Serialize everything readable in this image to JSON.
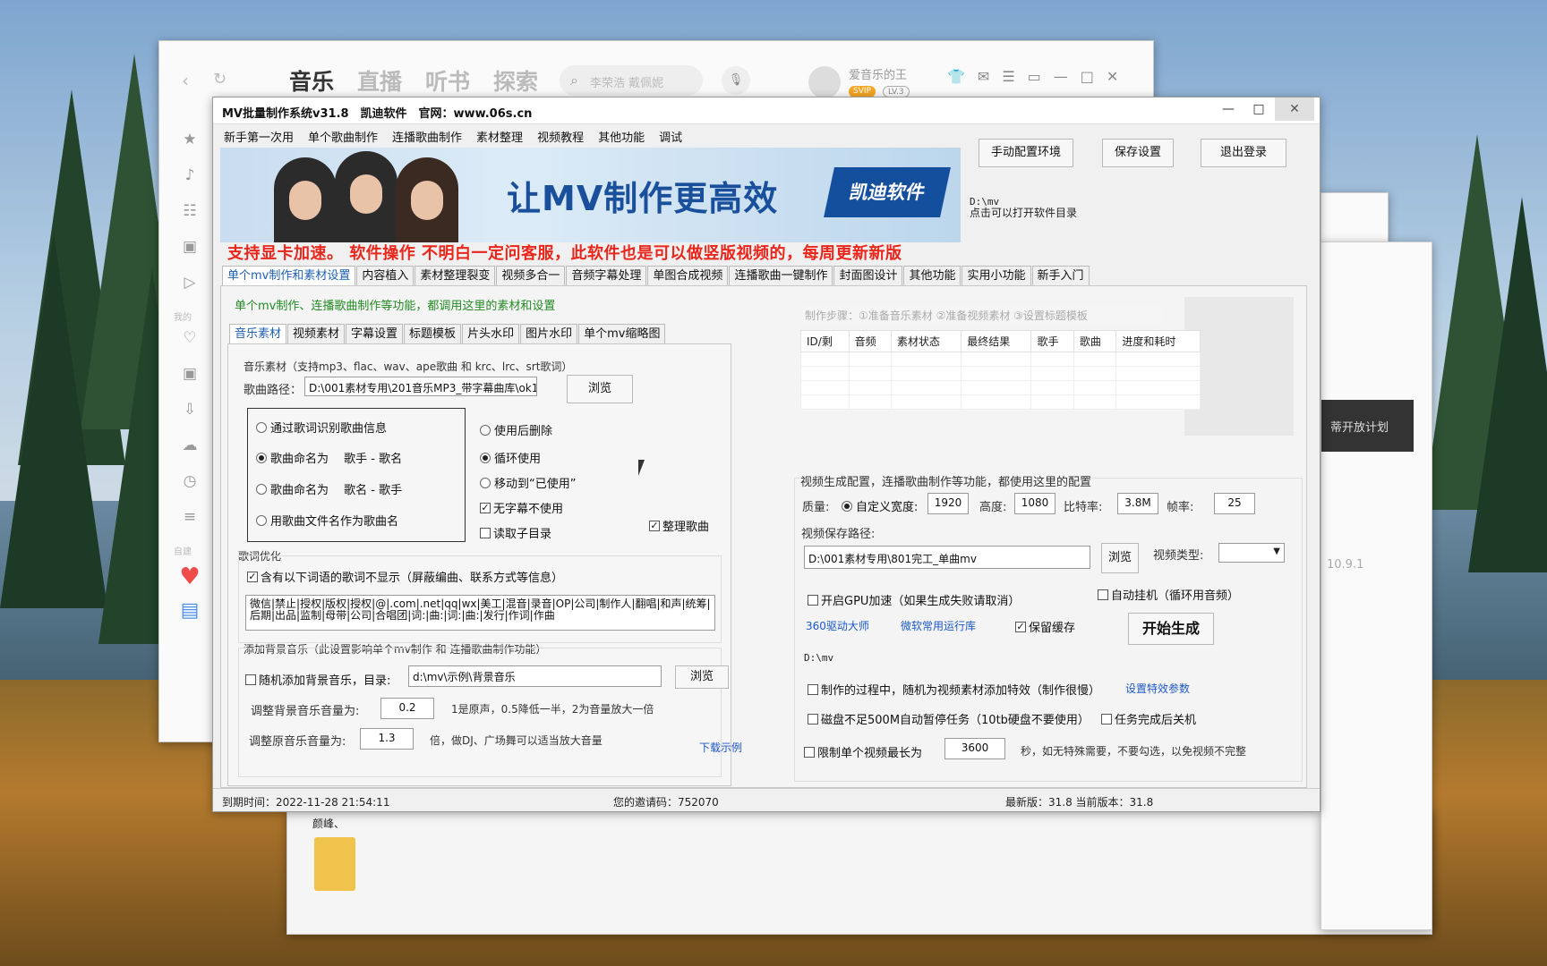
{
  "music_app": {
    "tabs": [
      "音乐",
      "直播",
      "听书",
      "探索"
    ],
    "active_tab": "音乐",
    "search_placeholder": "李荣浩 戴佩妮",
    "user_name": "爱音乐的王",
    "svip_badge": "SVIP",
    "level_badge": "LV.3",
    "side_label_mine": "我的",
    "side_label_create": "自建",
    "back_panel_text": "蒂开放计划",
    "back_version": "10.9.1"
  },
  "file_window": {
    "file_label": "颜峰、"
  },
  "mv_app": {
    "title": "MV批量制作系统v31.8　凯迪软件　官网：www.06s.cn",
    "menu": [
      "新手第一次用",
      "单个歌曲制作",
      "连播歌曲制作",
      "素材整理",
      "视频教程",
      "其他功能",
      "调试"
    ],
    "banner_slogan": "让MV制作更高效",
    "banner_brand": "凯迪软件",
    "buttons": {
      "manual_env": "手动配置环境",
      "save_settings": "保存设置",
      "logout": "退出登录",
      "browse": "浏览",
      "start": "开始生成"
    },
    "dir_path": "D:\\mv",
    "dir_hint": "点击可以打开软件目录",
    "red_notice": "支持显卡加速。 软件操作 不明白一定问客服，此软件也是可以做竖版视频的，每周更新新版",
    "main_tabs": [
      "单个mv制作和素材设置",
      "内容植入",
      "素材整理裂变",
      "视频多合一",
      "音频字幕处理",
      "单图合成视频",
      "连播歌曲一键制作",
      "封面图设计",
      "其他功能",
      "实用小功能",
      "新手入门"
    ],
    "green_note": "单个mv制作、连播歌曲制作等功能，都调用这里的素材和设置",
    "sub_tabs": [
      "音乐素材",
      "视频素材",
      "字幕设置",
      "标题模板",
      "片头水印",
      "图片水印",
      "单个mv缩略图"
    ],
    "music_group_title": "音乐素材（支持mp3、flac、wav、ape歌曲 和 krc、lrc、srt歌词）",
    "song_path_label": "歌曲路径：",
    "song_path": "D:\\001素材专用\\201音乐MP3_带字幕曲库\\ok11-3",
    "naming_options": [
      "通过歌词识别歌曲信息",
      "歌曲命名为　 歌手 - 歌名",
      "歌曲命名为　 歌名 - 歌手",
      "用歌曲文件名作为歌曲名"
    ],
    "naming_selected": 1,
    "usage_options": [
      "使用后删除",
      "循环使用",
      "移动到“已使用”"
    ],
    "usage_selected": 1,
    "chk_no_subtitle": "无字幕不使用",
    "chk_read_subdir": "读取子目录",
    "chk_organize": "整理歌曲",
    "lyrics_group_title": "歌词优化",
    "lyrics_check": "含有以下词语的歌词不显示（屏蔽编曲、联系方式等信息）",
    "lyrics_words": "微信|禁止|授权|版权|授权|@|.com|.net|qq|wx|美工|混音|录音|OP|公司|制作人|翻唱|和声|统筹|后期|出品|监制|母带|公司|合唱团|词:|曲:|词:|曲:|发行|作词|作曲",
    "bg_group_title": "添加背景音乐（此设置影响单个mv制作 和 连播歌曲制作功能）",
    "bg_random": "随机添加背景音乐，目录:",
    "bg_dir": "d:\\mv\\示例\\背景音乐",
    "bg_vol_label": "调整背景音乐音量为:",
    "bg_vol": "0.2",
    "bg_vol_hint": "1是原声，0.5降低一半，2为音量放大一倍",
    "orig_vol_label": "调整原音乐音量为:",
    "orig_vol": "1.3",
    "orig_vol_hint": "倍，做DJ、广场舞可以适当放大音量",
    "download_example": "下载示例",
    "steps_text": "制作步骤：①准备音乐素材 ②准备视频素材 ③设置标题模板",
    "table_headers": [
      "ID/剩",
      "音频",
      "素材状态",
      "最终结果",
      "歌手",
      "歌曲",
      "进度和耗时"
    ],
    "video_config_title": "视频生成配置，连播歌曲制作等功能，都使用这里的配置",
    "quality_label": "质量:",
    "custom_width": "自定义宽度:",
    "width": "1920",
    "height_label": "高度:",
    "height": "1080",
    "bitrate_label": "比特率:",
    "bitrate": "3.8M",
    "fps_label": "帧率:",
    "fps": "25",
    "save_path_label": "视频保存路径:",
    "save_path": "D:\\001素材专用\\801完工_单曲mv",
    "video_type_label": "视频类型:",
    "gpu_check": "开启GPU加速（如果生成失败请取消）",
    "auto_hang": "自动挂机（循环用音频）",
    "link_360": "360驱动大师",
    "link_runtime": "微软常用运行库",
    "keep_cache": "保留缓存",
    "output_dir": "D:\\mv",
    "random_effect": "制作的过程中，随机为视频素材添加特效（制作很慢）",
    "effect_params": "设置特效参数",
    "disk_pause": "磁盘不足500M自动暂停任务（10tb硬盘不要使用）",
    "shutdown": "任务完成后关机",
    "limit_len": "限制单个视频最长为",
    "limit_value": "3600",
    "limit_hint": "秒，如无特殊需要，不要勾选，以免视频不完整",
    "status_expire": "到期时间：2022-11-28 21:54:11",
    "status_invite": "您的邀请码：752070",
    "status_version": "最新版：31.8 当前版本：31.8"
  }
}
